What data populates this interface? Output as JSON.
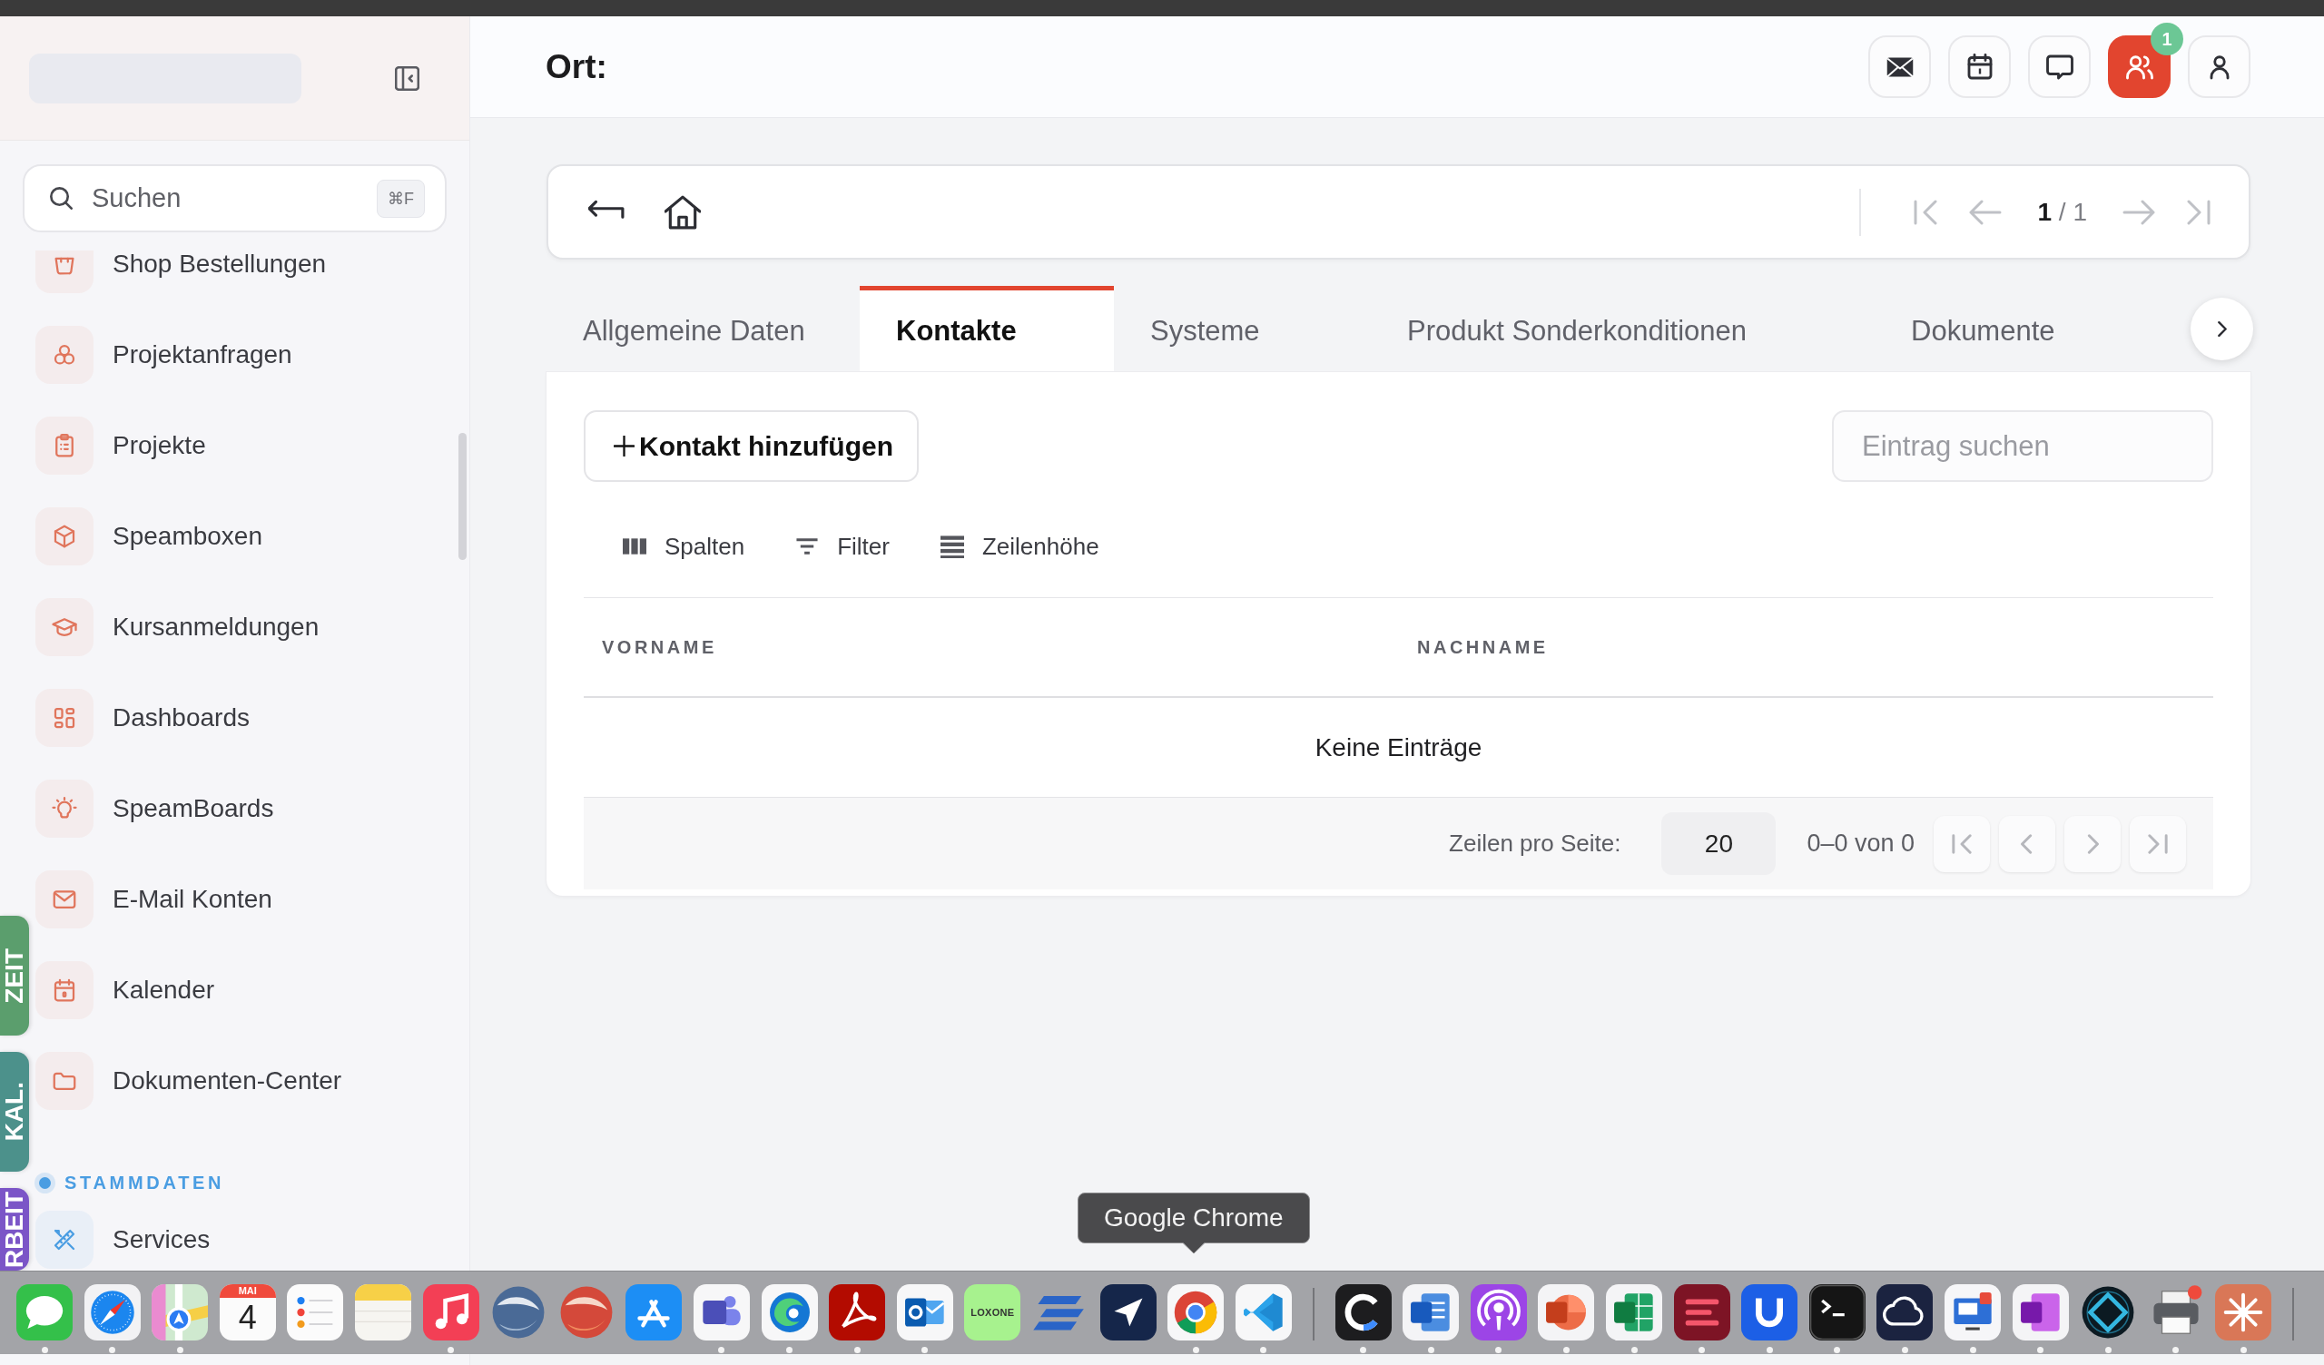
{
  "sidebar": {
    "search": {
      "placeholder": "Suchen",
      "shortcut": "⌘F"
    },
    "sections": [
      {
        "items": [
          {
            "label": "Shop Bestellungen"
          },
          {
            "label": "Projektanfragen"
          },
          {
            "label": "Projekte"
          },
          {
            "label": "Speamboxen"
          },
          {
            "label": "Kursanmeldungen"
          },
          {
            "label": "Dashboards"
          },
          {
            "label": "SpeamBoards"
          },
          {
            "label": "E-Mail Konten"
          },
          {
            "label": "Kalender"
          },
          {
            "label": "Dokumenten-Center"
          }
        ]
      },
      {
        "title": "STAMMDATEN",
        "color": "#4a9de2",
        "items": [
          {
            "label": "Services"
          }
        ]
      }
    ]
  },
  "side_tabs": [
    {
      "label": "ZEIT",
      "color": "#5b9e6d"
    },
    {
      "label": "KAL.",
      "color": "#4c918b"
    },
    {
      "label": "RBEIT",
      "color": "#7b55c7"
    }
  ],
  "header": {
    "title": "Ort:",
    "buttons": [
      {
        "active": false
      },
      {
        "active": false
      },
      {
        "active": false
      },
      {
        "active": true,
        "badge": "1"
      },
      {
        "active": false
      }
    ]
  },
  "record_bar": {
    "buttons": [
      {
        "disabled": false
      },
      {
        "disabled": false
      }
    ],
    "pager": {
      "page": "1",
      "of": "/ 1",
      "buttons": [
        {
          "disabled": true
        },
        {
          "disabled": true
        },
        {
          "disabled": true
        },
        {
          "disabled": true
        }
      ]
    }
  },
  "tabs": [
    {
      "label": "Allgemeine Daten",
      "selected": false
    },
    {
      "label": "Kontakte",
      "selected": true
    },
    {
      "label": "Systeme",
      "selected": false
    },
    {
      "label": "Produkt Sonderkonditionen",
      "selected": false
    },
    {
      "label": "Dokumente",
      "selected": false
    }
  ],
  "contacts": {
    "add_button": "Kontakt hinzufügen",
    "search": {
      "placeholder": "Eintrag suchen"
    },
    "toolbar": [
      {
        "label": "Spalten"
      },
      {
        "label": "Filter"
      },
      {
        "label": "Zeilenhöhe"
      }
    ],
    "table": {
      "columns": [
        "VORNAME",
        "NACHNAME"
      ],
      "empty_text": "Keine Einträge"
    },
    "footer": {
      "rows_per_page_label": "Zeilen pro Seite:",
      "rows_per_page": "20",
      "range": "0–0 von 0",
      "buttons": [
        {
          "disabled": true
        },
        {
          "disabled": true
        },
        {
          "disabled": true
        },
        {
          "disabled": true
        }
      ]
    }
  },
  "dock": {
    "tooltip": "Google Chrome",
    "items": [
      {
        "kind": "app",
        "running": true
      },
      {
        "kind": "app",
        "running": true
      },
      {
        "kind": "app",
        "running": true
      },
      {
        "kind": "calendar",
        "month": "MAI",
        "day": "4",
        "running": false
      },
      {
        "kind": "app",
        "running": false
      },
      {
        "kind": "app",
        "running": false
      },
      {
        "kind": "app",
        "running": true
      },
      {
        "kind": "app",
        "running": false
      },
      {
        "kind": "app",
        "running": false
      },
      {
        "kind": "app",
        "running": false
      },
      {
        "kind": "app",
        "running": true
      },
      {
        "kind": "app",
        "running": true
      },
      {
        "kind": "app",
        "running": true
      },
      {
        "kind": "app",
        "running": true
      },
      {
        "kind": "wordmark",
        "label": "LOXONE",
        "running": false
      },
      {
        "kind": "app",
        "running": false
      },
      {
        "kind": "app",
        "running": false
      },
      {
        "kind": "app",
        "running": true
      },
      {
        "kind": "app",
        "running": true
      },
      {
        "kind": "separator"
      },
      {
        "kind": "app",
        "running": true
      },
      {
        "kind": "app",
        "running": true
      },
      {
        "kind": "app",
        "running": true
      },
      {
        "kind": "app",
        "running": true
      },
      {
        "kind": "app",
        "running": true
      },
      {
        "kind": "app",
        "running": true
      },
      {
        "kind": "app",
        "running": true
      },
      {
        "kind": "app",
        "running": true
      },
      {
        "kind": "app",
        "running": true
      },
      {
        "kind": "app",
        "running": true
      },
      {
        "kind": "app",
        "running": true
      },
      {
        "kind": "app",
        "running": true
      },
      {
        "kind": "app",
        "running": true
      },
      {
        "kind": "app",
        "running": true
      },
      {
        "kind": "separator"
      }
    ]
  }
}
